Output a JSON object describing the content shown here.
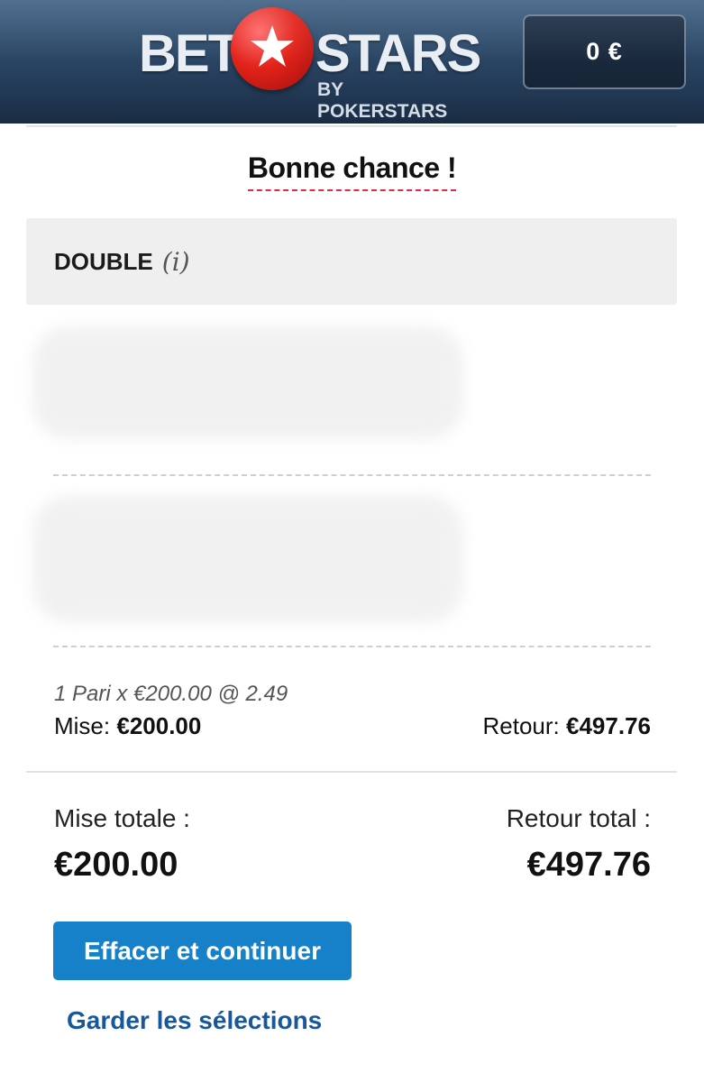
{
  "header": {
    "logo_bet": "BET",
    "logo_stars": "STARS",
    "logo_sub": "BY POKERSTARS",
    "balance": "0 €"
  },
  "message": "Bonne chance !",
  "bet": {
    "type": "DOUBLE",
    "info_icon_text": "(i)",
    "summary": "1 Pari x €200.00 @ 2.49",
    "stake_label": "Mise:",
    "stake_value": "€200.00",
    "return_label": "Retour:",
    "return_value": "€497.76"
  },
  "totals": {
    "stake_label": "Mise totale :",
    "stake_value": "€200.00",
    "return_label": "Retour total :",
    "return_value": "€497.76"
  },
  "actions": {
    "clear_continue": "Effacer et continuer",
    "keep_selections": "Garder les sélections"
  },
  "icons": {
    "logo_ball": "star-ball-icon",
    "info": "info-icon"
  },
  "colors": {
    "header_bg": "#2b4766",
    "primary_button": "#1680c8",
    "link": "#17579a",
    "accent_dash": "#e2294a",
    "logo_red": "#e2231a"
  }
}
